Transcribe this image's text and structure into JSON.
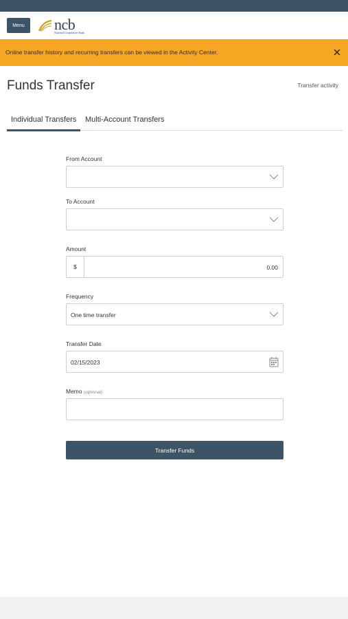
{
  "header": {
    "menu_label": "Menu",
    "logo_word": "ncb",
    "logo_sub": "National Cooperative Bank"
  },
  "banner": {
    "message": "Online transfer history and recurring transfers can be viewed in the Activity Center.",
    "close_icon": "close-icon"
  },
  "page": {
    "title": "Funds Transfer",
    "activity_link": "Transfer activity"
  },
  "tabs": [
    {
      "label": "Individual Transfers",
      "active": true
    },
    {
      "label": "Multi-Account Transfers",
      "active": false
    }
  ],
  "form": {
    "from_account": {
      "label": "From Account",
      "value": ""
    },
    "to_account": {
      "label": "To Account",
      "value": ""
    },
    "amount": {
      "label": "Amount",
      "currency": "$",
      "value": "0.00"
    },
    "frequency": {
      "label": "Frequency",
      "value": "One time transfer"
    },
    "transfer_date": {
      "label": "Transfer Date",
      "value": "02/15/2023"
    },
    "memo": {
      "label": "Memo",
      "optional": "(optional)",
      "value": ""
    },
    "submit_label": "Transfer Funds"
  },
  "colors": {
    "primary": "#3d5466",
    "banner": "#f5a623"
  }
}
